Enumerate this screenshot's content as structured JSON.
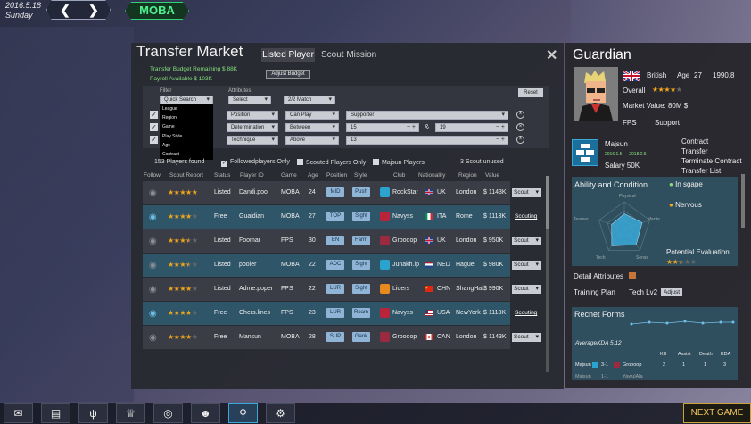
{
  "date": {
    "line1": "2016.5.18",
    "line2": "Sunday"
  },
  "nav": {
    "back": "❮",
    "forward": "❯",
    "mode_tab": "MOBA"
  },
  "window": {
    "title": "Transfer Market",
    "tabs": [
      "Listed Player",
      "Scout Mission"
    ],
    "close": "✕"
  },
  "budget": {
    "remaining": "Transfer Budget Remaining $ 88K",
    "payroll": "Payroll Available $ 103K",
    "adjust_button": "Adjust Budget"
  },
  "filter": {
    "filter_label": "Filter",
    "attr_label": "Attributes",
    "reset": "Reset",
    "quick_search": "Quick Search",
    "select": "Select",
    "match": "2/2 Match",
    "dropdown_options": [
      "League",
      "Region",
      "Game",
      "Play Style",
      "Age",
      "Contract"
    ],
    "rows": [
      {
        "field": "Position",
        "op": "Can Play",
        "value": "Supporter",
        "value2": ""
      },
      {
        "field": "Determination",
        "op": "Between",
        "value": "15",
        "value2": "19",
        "amp": "&"
      },
      {
        "field": "Technique",
        "op": "Above",
        "value": "13",
        "value2": ""
      }
    ],
    "players_found": "153 Players found",
    "followed": "Followedplayers Only",
    "scouted": "Scouted Players Only",
    "majsun": "Majsun Players",
    "scout_unused": "3 Scout unused"
  },
  "table": {
    "headers": [
      "Follow",
      "Scout Report",
      "Status",
      "Player ID",
      "Game",
      "Age",
      "Position",
      "Style",
      "Club",
      "Nationality",
      "Region",
      "Value"
    ],
    "rows": [
      {
        "stars": 5,
        "status": "Listed",
        "id": "Dandi.poo",
        "game": "MOBA",
        "age": "24",
        "pos": "MID",
        "style": "Push",
        "club": "RockStar",
        "nat": "UK",
        "region": "London",
        "value": "$ 1143K",
        "action": "Scout",
        "action_type": "dropdown",
        "club_color": "#2aa3cf",
        "flag": "uk",
        "eye": "off"
      },
      {
        "stars": 4,
        "status": "Free",
        "id": "Guaidian",
        "game": "MOBA",
        "age": "27",
        "pos": "TOP",
        "style": "Sight",
        "club": "Navyss",
        "nat": "ITA",
        "region": "Rome",
        "value": "$ 1113K",
        "action": "Scouting",
        "action_type": "link",
        "club_color": "#b9243a",
        "flag": "ita",
        "eye": "on"
      },
      {
        "stars": 3.5,
        "status": "Listed",
        "id": "Foomar",
        "game": "FPS",
        "age": "30",
        "pos": "EN",
        "style": "Farm",
        "club": "Groooop",
        "nat": "UK",
        "region": "London",
        "value": "$ 950K",
        "action": "Scout",
        "action_type": "dropdown",
        "club_color": "#9a2a3f",
        "flag": "uk",
        "eye": "off"
      },
      {
        "stars": 3.5,
        "status": "Listed",
        "id": "pooler",
        "game": "MOBA",
        "age": "22",
        "pos": "ADC",
        "style": "Sight",
        "club": "Junakh.lp",
        "nat": "NED",
        "region": "Hague",
        "value": "$ 980K",
        "action": "Scout",
        "action_type": "dropdown",
        "club_color": "#2aa3cf",
        "flag": "ned",
        "eye": "off"
      },
      {
        "stars": 4,
        "status": "Listed",
        "id": "Adme.poper",
        "game": "FPS",
        "age": "22",
        "pos": "LUR",
        "style": "Sight",
        "club": "Liders",
        "nat": "CHN",
        "region": "ShangHai",
        "value": "$ 990K",
        "action": "Scout",
        "action_type": "dropdown",
        "club_color": "#e88a1e",
        "flag": "chn",
        "eye": "off"
      },
      {
        "stars": 4,
        "status": "Free",
        "id": "Chers.lines",
        "game": "FPS",
        "age": "23",
        "pos": "LUR",
        "style": "Roam",
        "club": "Navyss",
        "nat": "USA",
        "region": "NewYork",
        "value": "$ 1113K",
        "action": "Scouting",
        "action_type": "link",
        "club_color": "#b9243a",
        "flag": "usa",
        "eye": "on"
      },
      {
        "stars": 4,
        "status": "Free",
        "id": "Mansun",
        "game": "MOBA",
        "age": "28",
        "pos": "SUP",
        "style": "Gank",
        "club": "Groooop",
        "nat": "CAN",
        "region": "London",
        "value": "$ 1143K",
        "action": "Scout",
        "action_type": "dropdown",
        "club_color": "#9a2a3f",
        "flag": "can",
        "eye": "off"
      }
    ]
  },
  "profile": {
    "name": "Guardian",
    "nationality": "British",
    "age_label": "Age",
    "age": "27",
    "year": "1990.8",
    "overall_label": "Overall",
    "overall_stars": 4,
    "market_value": "Market Value:  80M $",
    "game": "FPS",
    "role": "Support",
    "team": "Majsun",
    "team_dates": "2016.1.5 — 2018.2.5",
    "salary": "Salary  50K",
    "contract_menu": [
      "Contract",
      "Transfer",
      "Terminate Contract",
      "Transfer List"
    ],
    "ability_title": "Ability and Condition",
    "condition1": "In sgape",
    "condition2": "Nervous",
    "radar_labels": [
      "Physical",
      "Mente",
      "Sense",
      "Tech",
      "Teamer"
    ],
    "radar_values": [
      0.55,
      0.7,
      0.75,
      0.8,
      0.5
    ],
    "potential": "Potential Evaluation",
    "potential_stars": 2.5,
    "detail": "Detail Attributes",
    "training": "Training Plan",
    "tech": "Tech Lv2",
    "adjust": "Adjust",
    "forms_title": "Recnet Forms",
    "kda": "AverageKDA   5.12",
    "kda_headers": [
      "Kill",
      "Assist",
      "Death",
      "KDA"
    ],
    "kda_row": {
      "team": "Majsun",
      "score": "3-1",
      "opp": "Groooop",
      "kill": "2",
      "assist": "1",
      "death": "1",
      "kda": "3"
    },
    "kda_row2": {
      "team": "Majsun",
      "score": "1-1",
      "opp": "YawulAla"
    },
    "colors": {
      "accent": "#38a9d8",
      "star": "#f3a51b",
      "green": "#86e07c"
    }
  },
  "bottom": {
    "next_game": "NEXT GAME"
  }
}
